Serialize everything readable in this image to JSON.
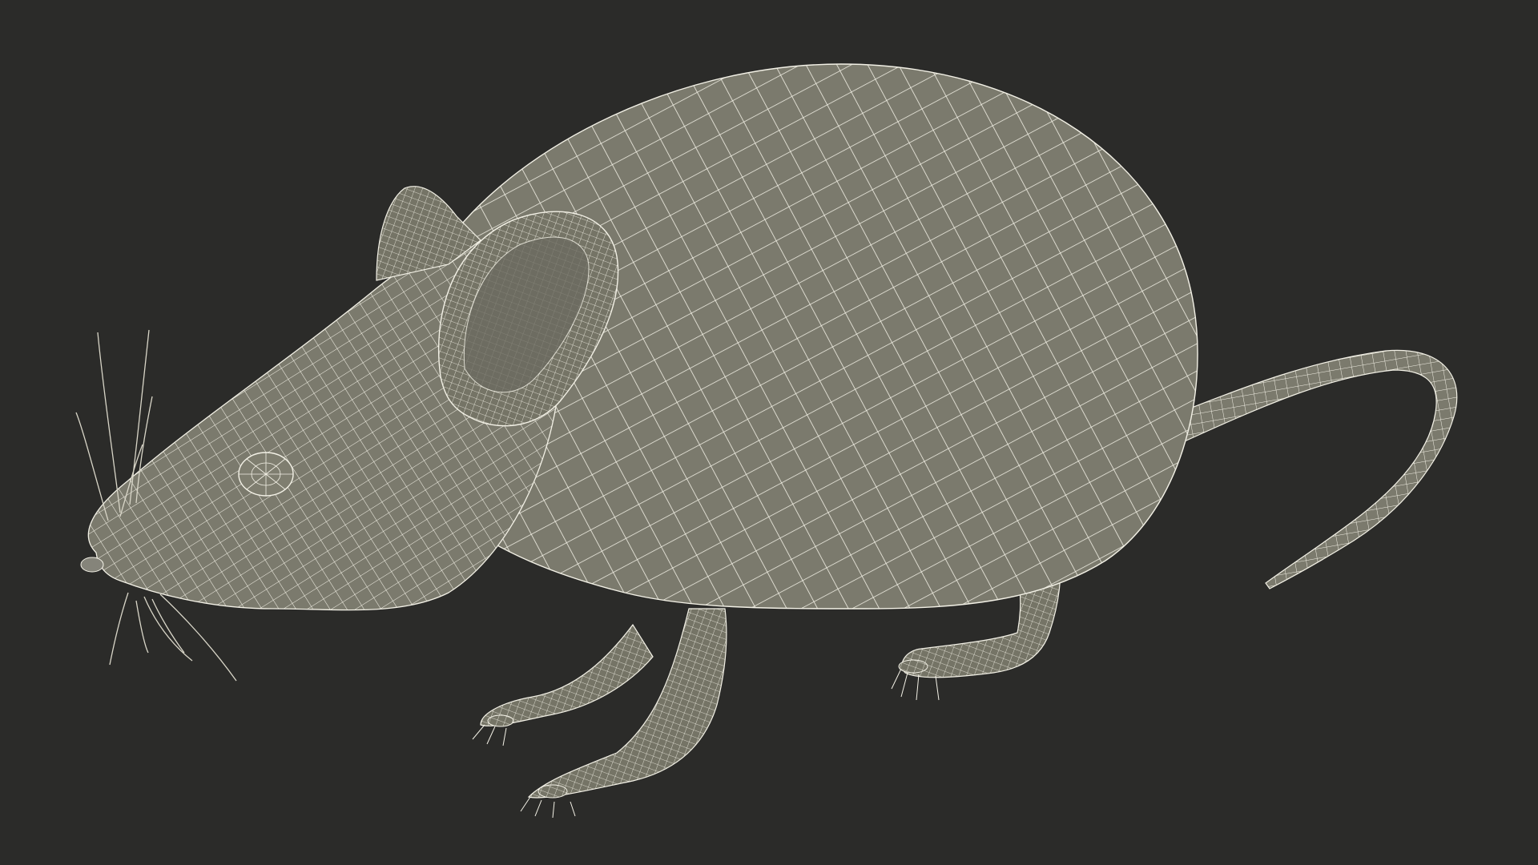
{
  "scene": {
    "subject": "wireframe-mouse-3d-model",
    "colors": {
      "background": "#2b2b29",
      "surface": "#7b7a6d",
      "surface_shade": "#6c6b60",
      "wire": "#f3f1e6",
      "whisker": "#d9d6c8"
    }
  }
}
